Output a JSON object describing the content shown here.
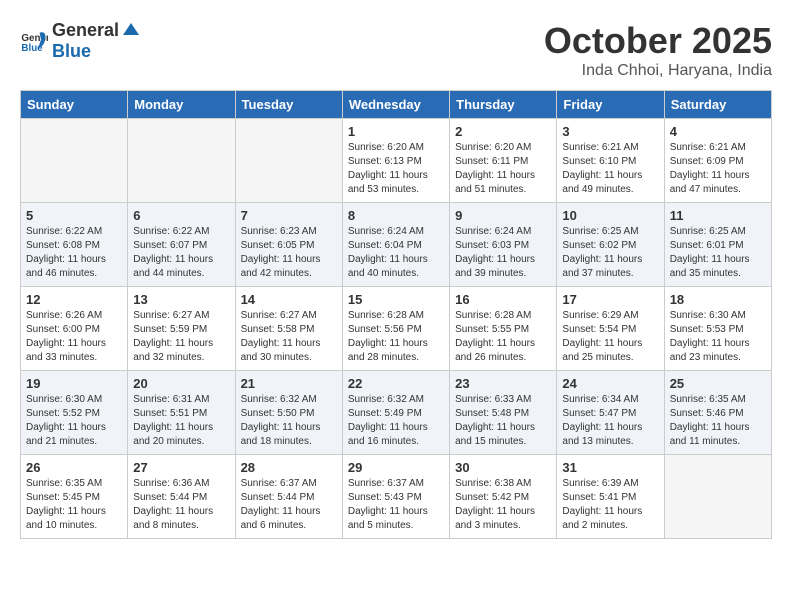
{
  "header": {
    "logo_general": "General",
    "logo_blue": "Blue",
    "month": "October 2025",
    "location": "Inda Chhoi, Haryana, India"
  },
  "weekdays": [
    "Sunday",
    "Monday",
    "Tuesday",
    "Wednesday",
    "Thursday",
    "Friday",
    "Saturday"
  ],
  "weeks": [
    [
      {
        "day": "",
        "sunrise": "",
        "sunset": "",
        "daylight": "",
        "empty": true
      },
      {
        "day": "",
        "sunrise": "",
        "sunset": "",
        "daylight": "",
        "empty": true
      },
      {
        "day": "",
        "sunrise": "",
        "sunset": "",
        "daylight": "",
        "empty": true
      },
      {
        "day": "1",
        "sunrise": "Sunrise: 6:20 AM",
        "sunset": "Sunset: 6:13 PM",
        "daylight": "Daylight: 11 hours and 53 minutes."
      },
      {
        "day": "2",
        "sunrise": "Sunrise: 6:20 AM",
        "sunset": "Sunset: 6:11 PM",
        "daylight": "Daylight: 11 hours and 51 minutes."
      },
      {
        "day": "3",
        "sunrise": "Sunrise: 6:21 AM",
        "sunset": "Sunset: 6:10 PM",
        "daylight": "Daylight: 11 hours and 49 minutes."
      },
      {
        "day": "4",
        "sunrise": "Sunrise: 6:21 AM",
        "sunset": "Sunset: 6:09 PM",
        "daylight": "Daylight: 11 hours and 47 minutes."
      }
    ],
    [
      {
        "day": "5",
        "sunrise": "Sunrise: 6:22 AM",
        "sunset": "Sunset: 6:08 PM",
        "daylight": "Daylight: 11 hours and 46 minutes."
      },
      {
        "day": "6",
        "sunrise": "Sunrise: 6:22 AM",
        "sunset": "Sunset: 6:07 PM",
        "daylight": "Daylight: 11 hours and 44 minutes."
      },
      {
        "day": "7",
        "sunrise": "Sunrise: 6:23 AM",
        "sunset": "Sunset: 6:05 PM",
        "daylight": "Daylight: 11 hours and 42 minutes."
      },
      {
        "day": "8",
        "sunrise": "Sunrise: 6:24 AM",
        "sunset": "Sunset: 6:04 PM",
        "daylight": "Daylight: 11 hours and 40 minutes."
      },
      {
        "day": "9",
        "sunrise": "Sunrise: 6:24 AM",
        "sunset": "Sunset: 6:03 PM",
        "daylight": "Daylight: 11 hours and 39 minutes."
      },
      {
        "day": "10",
        "sunrise": "Sunrise: 6:25 AM",
        "sunset": "Sunset: 6:02 PM",
        "daylight": "Daylight: 11 hours and 37 minutes."
      },
      {
        "day": "11",
        "sunrise": "Sunrise: 6:25 AM",
        "sunset": "Sunset: 6:01 PM",
        "daylight": "Daylight: 11 hours and 35 minutes."
      }
    ],
    [
      {
        "day": "12",
        "sunrise": "Sunrise: 6:26 AM",
        "sunset": "Sunset: 6:00 PM",
        "daylight": "Daylight: 11 hours and 33 minutes."
      },
      {
        "day": "13",
        "sunrise": "Sunrise: 6:27 AM",
        "sunset": "Sunset: 5:59 PM",
        "daylight": "Daylight: 11 hours and 32 minutes."
      },
      {
        "day": "14",
        "sunrise": "Sunrise: 6:27 AM",
        "sunset": "Sunset: 5:58 PM",
        "daylight": "Daylight: 11 hours and 30 minutes."
      },
      {
        "day": "15",
        "sunrise": "Sunrise: 6:28 AM",
        "sunset": "Sunset: 5:56 PM",
        "daylight": "Daylight: 11 hours and 28 minutes."
      },
      {
        "day": "16",
        "sunrise": "Sunrise: 6:28 AM",
        "sunset": "Sunset: 5:55 PM",
        "daylight": "Daylight: 11 hours and 26 minutes."
      },
      {
        "day": "17",
        "sunrise": "Sunrise: 6:29 AM",
        "sunset": "Sunset: 5:54 PM",
        "daylight": "Daylight: 11 hours and 25 minutes."
      },
      {
        "day": "18",
        "sunrise": "Sunrise: 6:30 AM",
        "sunset": "Sunset: 5:53 PM",
        "daylight": "Daylight: 11 hours and 23 minutes."
      }
    ],
    [
      {
        "day": "19",
        "sunrise": "Sunrise: 6:30 AM",
        "sunset": "Sunset: 5:52 PM",
        "daylight": "Daylight: 11 hours and 21 minutes."
      },
      {
        "day": "20",
        "sunrise": "Sunrise: 6:31 AM",
        "sunset": "Sunset: 5:51 PM",
        "daylight": "Daylight: 11 hours and 20 minutes."
      },
      {
        "day": "21",
        "sunrise": "Sunrise: 6:32 AM",
        "sunset": "Sunset: 5:50 PM",
        "daylight": "Daylight: 11 hours and 18 minutes."
      },
      {
        "day": "22",
        "sunrise": "Sunrise: 6:32 AM",
        "sunset": "Sunset: 5:49 PM",
        "daylight": "Daylight: 11 hours and 16 minutes."
      },
      {
        "day": "23",
        "sunrise": "Sunrise: 6:33 AM",
        "sunset": "Sunset: 5:48 PM",
        "daylight": "Daylight: 11 hours and 15 minutes."
      },
      {
        "day": "24",
        "sunrise": "Sunrise: 6:34 AM",
        "sunset": "Sunset: 5:47 PM",
        "daylight": "Daylight: 11 hours and 13 minutes."
      },
      {
        "day": "25",
        "sunrise": "Sunrise: 6:35 AM",
        "sunset": "Sunset: 5:46 PM",
        "daylight": "Daylight: 11 hours and 11 minutes."
      }
    ],
    [
      {
        "day": "26",
        "sunrise": "Sunrise: 6:35 AM",
        "sunset": "Sunset: 5:45 PM",
        "daylight": "Daylight: 11 hours and 10 minutes."
      },
      {
        "day": "27",
        "sunrise": "Sunrise: 6:36 AM",
        "sunset": "Sunset: 5:44 PM",
        "daylight": "Daylight: 11 hours and 8 minutes."
      },
      {
        "day": "28",
        "sunrise": "Sunrise: 6:37 AM",
        "sunset": "Sunset: 5:44 PM",
        "daylight": "Daylight: 11 hours and 6 minutes."
      },
      {
        "day": "29",
        "sunrise": "Sunrise: 6:37 AM",
        "sunset": "Sunset: 5:43 PM",
        "daylight": "Daylight: 11 hours and 5 minutes."
      },
      {
        "day": "30",
        "sunrise": "Sunrise: 6:38 AM",
        "sunset": "Sunset: 5:42 PM",
        "daylight": "Daylight: 11 hours and 3 minutes."
      },
      {
        "day": "31",
        "sunrise": "Sunrise: 6:39 AM",
        "sunset": "Sunset: 5:41 PM",
        "daylight": "Daylight: 11 hours and 2 minutes."
      },
      {
        "day": "",
        "sunrise": "",
        "sunset": "",
        "daylight": "",
        "empty": true
      }
    ]
  ]
}
